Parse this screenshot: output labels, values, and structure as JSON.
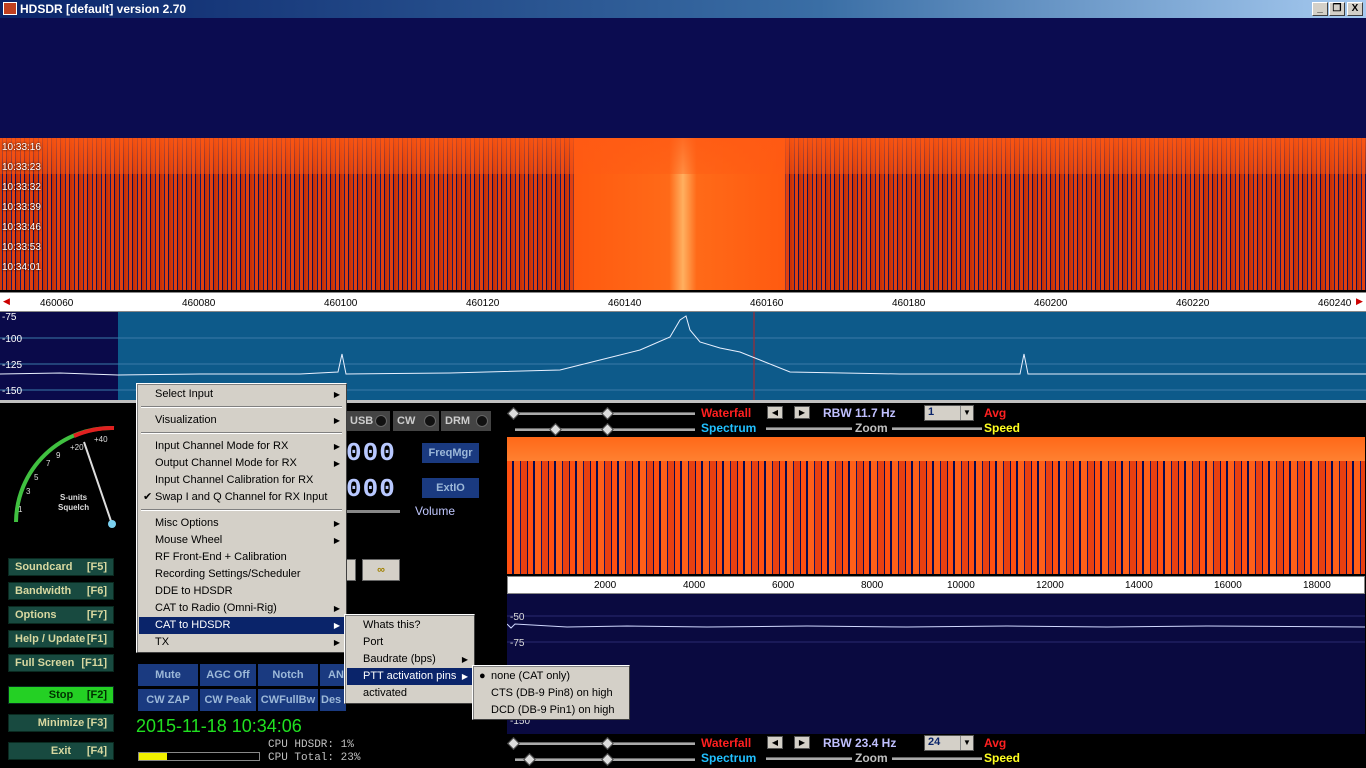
{
  "window": {
    "title": "HDSDR [default]  version 2.70",
    "min_glyph": "_",
    "max_glyph": "❐",
    "close_glyph": "X"
  },
  "waterfall_top": {
    "timestamps": [
      "10:33:16",
      "10:33:23",
      "10:33:32",
      "10:33:39",
      "10:33:46",
      "10:33:53",
      "10:34:01"
    ]
  },
  "freq_scale": {
    "labels": [
      "460060",
      "460080",
      "460100",
      "460120",
      "460140",
      "460160",
      "460180",
      "460200",
      "460220",
      "460240"
    ],
    "left_arrow": "◀",
    "right_arrow": "▶"
  },
  "spectrum_top": {
    "db_labels": [
      "-75",
      "-100",
      "-125",
      "-150"
    ]
  },
  "smeter": {
    "scale_labels": [
      "1",
      "3",
      "5",
      "7",
      "9",
      "+20",
      "+40"
    ],
    "label1": "S-units",
    "label2": "Squelch"
  },
  "mode_buttons": [
    "USB",
    "CW",
    "DRM"
  ],
  "side_buttons": {
    "freqmgr": "FreqMgr",
    "extio": "ExtIO",
    "volume": "Volume",
    "lo_digits": "000",
    "tune_digits": "000"
  },
  "function_buttons": [
    {
      "label": "Soundcard",
      "key": "[F5]"
    },
    {
      "label": "Bandwidth",
      "key": "[F6]"
    },
    {
      "label": "Options",
      "key": "[F7]"
    },
    {
      "label": "Help / Update",
      "key": "[F1]"
    },
    {
      "label": "Full Screen",
      "key": "[F11]"
    },
    {
      "label": "Stop",
      "key": "[F2]"
    },
    {
      "label": "Minimize",
      "key": "[F3]"
    },
    {
      "label": "Exit",
      "key": "[F4]"
    }
  ],
  "dsp_buttons": [
    "Mute",
    "AGC Off",
    "Notch",
    "AN",
    "CW ZAP",
    "CW Peak",
    "CWFullBw",
    "Des"
  ],
  "status": {
    "datetime": "2015-11-18 10:34:06",
    "cpu_hdsdr": "CPU HDSDR: 1%",
    "cpu_total": "CPU Total: 23%",
    "cpu_total_fraction": 0.23
  },
  "rf_controls": {
    "waterfall": "Waterfall",
    "spectrum": "Spectrum",
    "rbw": "RBW 11.7 Hz",
    "zoom": "Zoom",
    "avg": "Avg",
    "speed": "Speed",
    "avg_value": "1",
    "left_arrow": "◀",
    "right_arrow": "▶"
  },
  "af_controls": {
    "waterfall": "Waterfall",
    "spectrum": "Spectrum",
    "rbw": "RBW 23.4 Hz",
    "zoom": "Zoom",
    "avg": "Avg",
    "speed": "Speed",
    "avg_value": "24"
  },
  "audio_scale": {
    "labels": [
      "2000",
      "4000",
      "6000",
      "8000",
      "10000",
      "12000",
      "14000",
      "16000",
      "18000"
    ],
    "db_labels": [
      "-50",
      "-75",
      "-150"
    ]
  },
  "menu_main": {
    "items": [
      {
        "label": "Select Input",
        "sub": true
      },
      {
        "label": "Visualization",
        "sub": true
      },
      {
        "label": "Input Channel Mode for RX",
        "sub": true
      },
      {
        "label": "Output Channel Mode for RX",
        "sub": true
      },
      {
        "label": "Input Channel Calibration for RX",
        "sub": false
      },
      {
        "label": "Swap I and Q Channel for RX Input",
        "sub": false,
        "checked": true
      },
      {
        "label": "Misc Options",
        "sub": true
      },
      {
        "label": "Mouse Wheel",
        "sub": true
      },
      {
        "label": "RF Front-End + Calibration",
        "sub": false
      },
      {
        "label": "Recording Settings/Scheduler",
        "sub": false
      },
      {
        "label": "DDE to HDSDR",
        "sub": false
      },
      {
        "label": "CAT to Radio (Omni-Rig)",
        "sub": true
      },
      {
        "label": "CAT to HDSDR",
        "sub": true,
        "selected": true
      },
      {
        "label": "TX",
        "sub": true
      }
    ]
  },
  "menu_cat": {
    "items": [
      {
        "label": "Whats this?"
      },
      {
        "label": "Port"
      },
      {
        "label": "Baudrate (bps)",
        "sub": true
      },
      {
        "label": "PTT activation pins",
        "sub": true,
        "selected": true
      },
      {
        "label": "activated"
      }
    ]
  },
  "menu_ptt": {
    "items": [
      {
        "label": "none (CAT only)",
        "radio": true
      },
      {
        "label": "CTS (DB-9 Pin8) on high"
      },
      {
        "label": "DCD (DB-9 Pin1) on high"
      }
    ]
  },
  "glyphs": {
    "check": "✔",
    "radio": "●",
    "submenu": "▶",
    "dropdown": "▼"
  }
}
